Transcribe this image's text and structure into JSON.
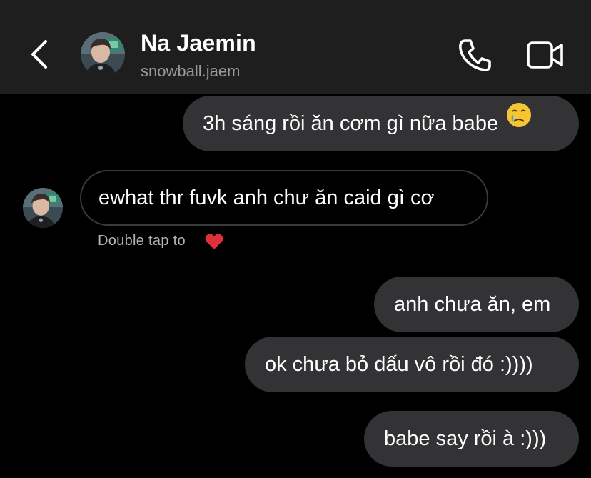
{
  "header": {
    "name": "Na Jaemin",
    "handle": "snowball.jaem",
    "back_icon": "chevron-left-icon",
    "call_icon": "phone-icon",
    "video_icon": "video-camera-icon"
  },
  "messages": [
    {
      "direction": "out",
      "text": "3h sáng rồi ăn cơm gì nữa babe",
      "emoji": "crying-face-emoji"
    },
    {
      "direction": "in",
      "text": "ewhat thr fuvk anh chư ăn caid gì cơ"
    },
    {
      "direction": "out",
      "text": "anh chưa ăn, em"
    },
    {
      "direction": "out",
      "text": "ok chưa bỏ dấu vô rồi đó :))))"
    },
    {
      "direction": "out",
      "text": "babe say rồi à :)))"
    }
  ],
  "reaction_hint": {
    "text": "Double tap to",
    "icon": "red-heart-icon"
  },
  "colors": {
    "header_bg": "#1e1e1e",
    "bubble_out": "#333335",
    "bubble_in_border": "#3a3a3a",
    "hint": "#b4b4b4",
    "heart": "#e0303a"
  }
}
